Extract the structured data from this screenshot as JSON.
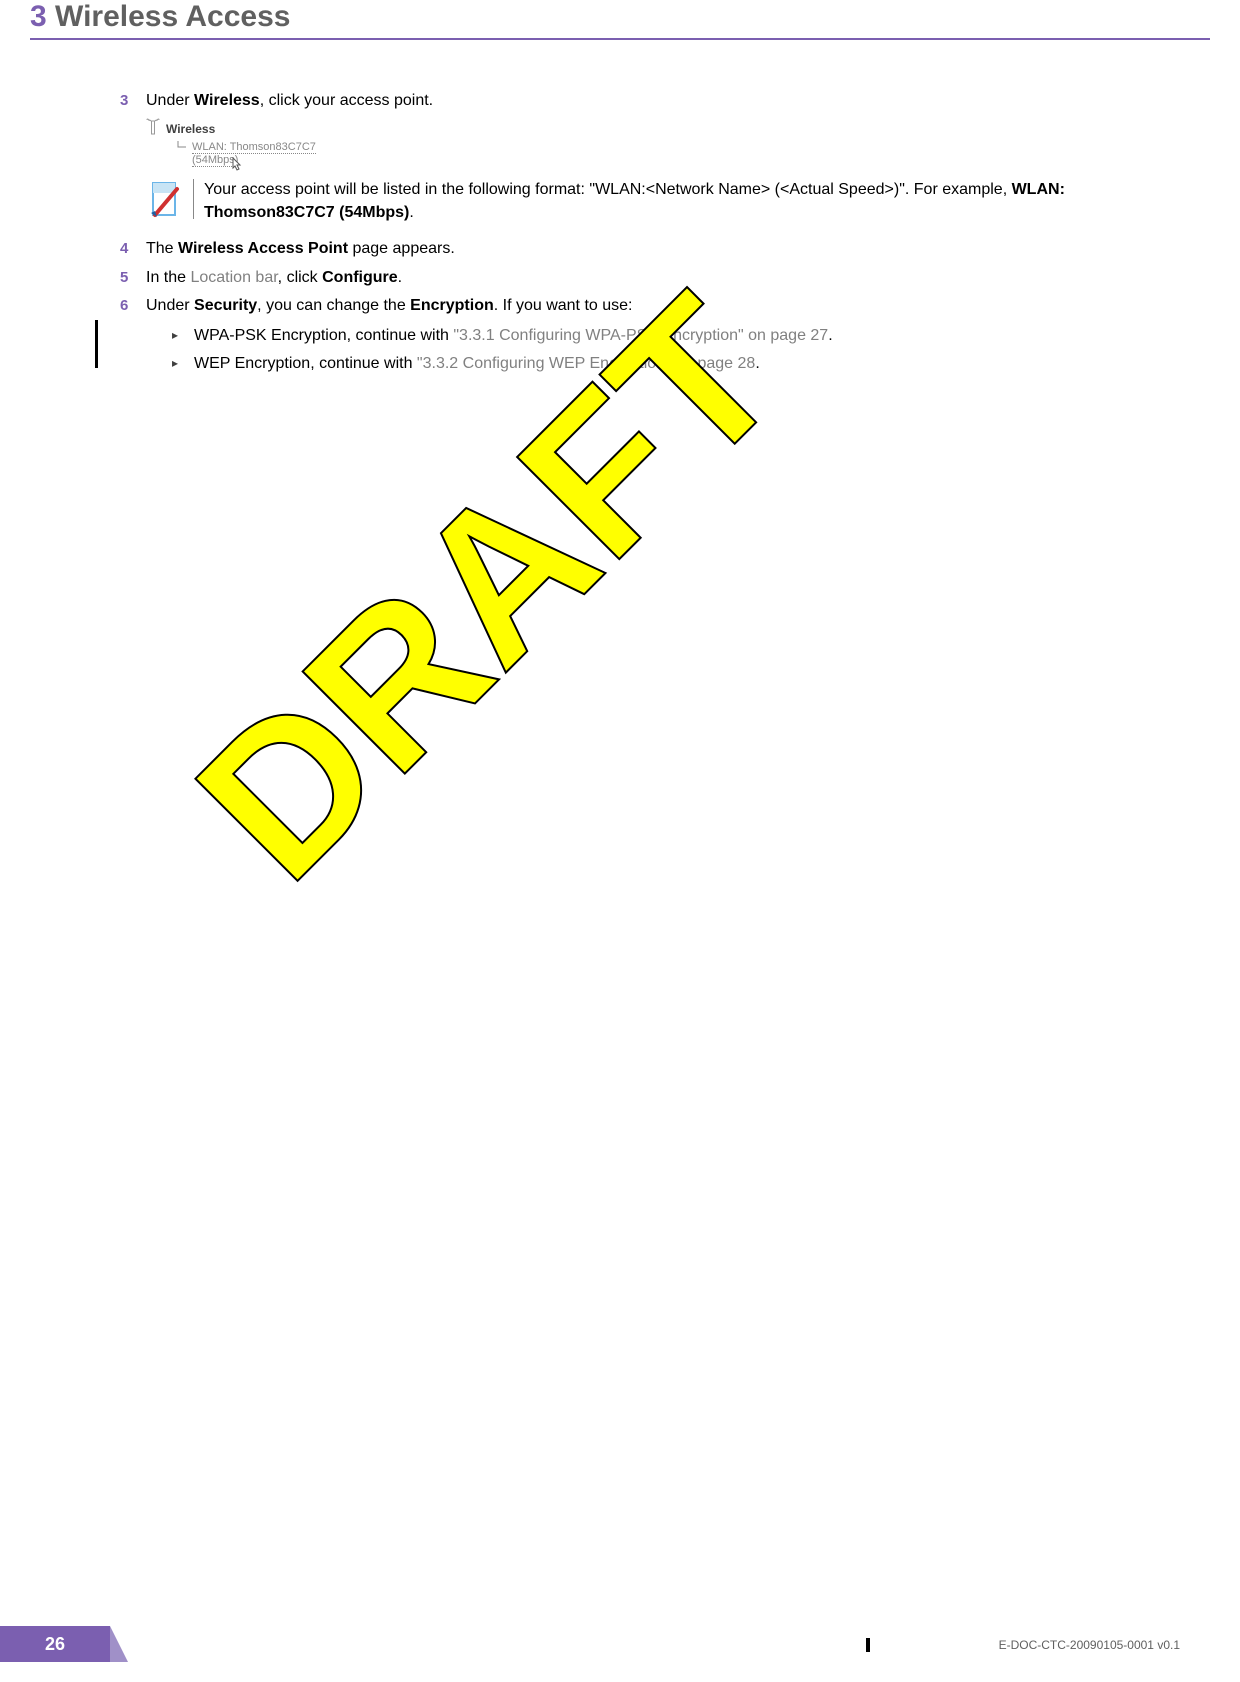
{
  "header": {
    "chapter_num": "3",
    "chapter_title": "Wireless Access"
  },
  "steps": {
    "s3": {
      "num": "3",
      "pre": "Under ",
      "bold": "Wireless",
      "post": ", click your access point."
    },
    "s4": {
      "num": "4",
      "pre": "The ",
      "bold": "Wireless Access Point",
      "post": " page appears."
    },
    "s5": {
      "num": "5",
      "pre": "In the ",
      "grey": "Location bar",
      "mid": ", click ",
      "bold": "Configure",
      "post": "."
    },
    "s6": {
      "num": "6",
      "pre": "Under ",
      "bold1": "Security",
      "mid": ", you can change the ",
      "bold2": "Encryption",
      "post": ". If you want to use:"
    }
  },
  "tree": {
    "label": "Wireless",
    "item": "WLAN: Thomson83C7C7",
    "speed": "(54Mbps)"
  },
  "note": {
    "part1": "Your access point will be listed in the following format: \"WLAN:<Network Name> (<Actual Speed>)\". For example, ",
    "bold": "WLAN: Thomson83C7C7 (54Mbps)",
    "part2": "."
  },
  "subitems": {
    "a": {
      "pre": "WPA-PSK Encryption, continue with ",
      "link": "\"3.3.1 Configuring WPA-PSK Encryption\" on page 27",
      "post": "."
    },
    "b": {
      "pre": "WEP Encryption, continue with ",
      "link": "\"3.3.2 Configuring WEP Encryption\" on page 28",
      "post": "."
    }
  },
  "watermark": "DRAFT",
  "footer": {
    "page": "26",
    "doc": "E-DOC-CTC-20090105-0001 v0.1"
  }
}
